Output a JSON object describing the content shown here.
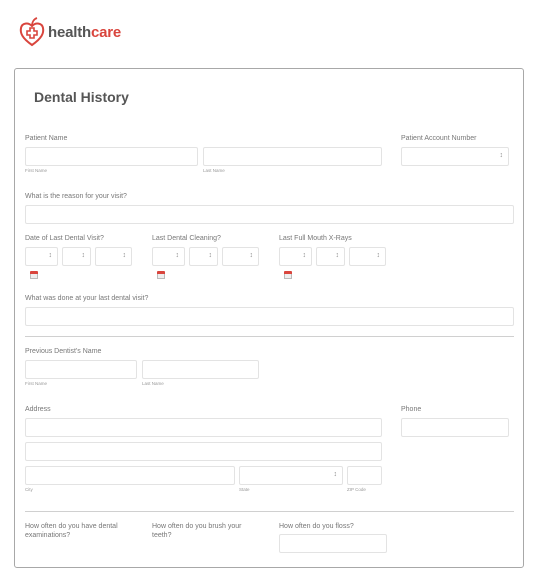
{
  "brand": {
    "name_part1": "health",
    "name_part2": "care",
    "color": "#d9453d"
  },
  "form": {
    "title": "Dental History",
    "patient_name": {
      "label": "Patient Name",
      "first_sub": "First Name",
      "last_sub": "Last Name"
    },
    "account_number": {
      "label": "Patient Account Number"
    },
    "reason": {
      "label": "What is the reason for your visit?"
    },
    "date_fields": [
      {
        "label": "Date of Last Dental Visit?"
      },
      {
        "label": "Last Dental Cleaning?"
      },
      {
        "label": "Last Full Mouth X-Rays"
      }
    ],
    "last_visit_done": {
      "label": "What was done at your last dental visit?"
    },
    "prev_dentist": {
      "label": "Previous Dentist's Name",
      "first_sub": "First Name",
      "last_sub": "Last Name"
    },
    "address": {
      "label": "Address",
      "city_sub": "City",
      "state_sub": "State",
      "zip_sub": "ZIP Code"
    },
    "phone": {
      "label": "Phone"
    },
    "questions": [
      {
        "label": "How often do you have dental examinations?"
      },
      {
        "label": "How often do you brush your teeth?"
      },
      {
        "label": "How often do you floss?"
      }
    ]
  }
}
